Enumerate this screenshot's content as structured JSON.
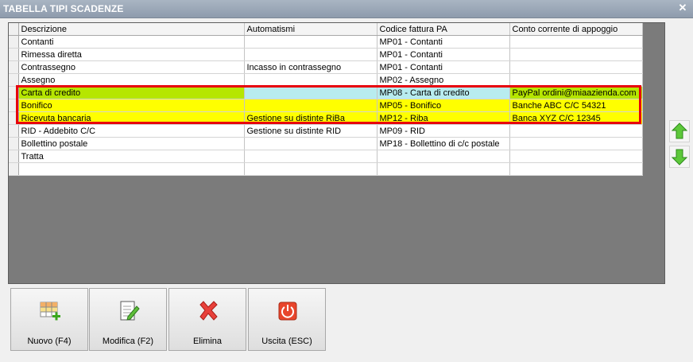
{
  "window": {
    "title": "TABELLA TIPI SCADENZE",
    "close_glyph": "✕"
  },
  "table": {
    "columns": [
      "Descrizione",
      "Automatismi",
      "Codice fattura PA",
      "Conto corrente di appoggio"
    ],
    "rows": [
      {
        "descrizione": "Contanti",
        "automatismi": "",
        "codice": "MP01 - Contanti",
        "conto": ""
      },
      {
        "descrizione": "Rimessa diretta",
        "automatismi": "",
        "codice": "MP01 - Contanti",
        "conto": ""
      },
      {
        "descrizione": "Contrassegno",
        "automatismi": "Incasso in contrassegno",
        "codice": "MP01 - Contanti",
        "conto": ""
      },
      {
        "descrizione": "Assegno",
        "automatismi": "",
        "codice": "MP02 - Assegno",
        "conto": ""
      },
      {
        "descrizione": "Carta di credito",
        "automatismi": "",
        "codice": "MP08 - Carta di credito",
        "conto": "PayPal ordini@miaazienda.com"
      },
      {
        "descrizione": "Bonifico",
        "automatismi": "",
        "codice": "MP05 - Bonifico",
        "conto": "Banche ABC C/C 54321"
      },
      {
        "descrizione": "Ricevuta bancaria",
        "automatismi": "Gestione su distinte RiBa",
        "codice": "MP12 - Riba",
        "conto": "Banca XYZ C/C 12345"
      },
      {
        "descrizione": "RID - Addebito C/C",
        "automatismi": "Gestione su distinte RID",
        "codice": "MP09 - RID",
        "conto": ""
      },
      {
        "descrizione": "Bollettino postale",
        "automatismi": "",
        "codice": "MP18 - Bollettino di c/c postale",
        "conto": ""
      },
      {
        "descrizione": "Tratta",
        "automatismi": "",
        "codice": "",
        "conto": ""
      },
      {
        "descrizione": "",
        "automatismi": "",
        "codice": "",
        "conto": ""
      }
    ]
  },
  "colors": {
    "selected_green": "#b6e600",
    "selected_cyan": "#b8ecef",
    "highlight_yellow": "#ffff00",
    "highlight_border": "#e8000b",
    "grid_background": "#7b7b7b"
  },
  "side_buttons": [
    {
      "name": "move-up-icon"
    },
    {
      "name": "move-down-icon"
    }
  ],
  "toolbar": {
    "new_label": "Nuovo (F4)",
    "edit_label": "Modifica (F2)",
    "delete_label": "Elimina",
    "exit_label": "Uscita (ESC)"
  }
}
